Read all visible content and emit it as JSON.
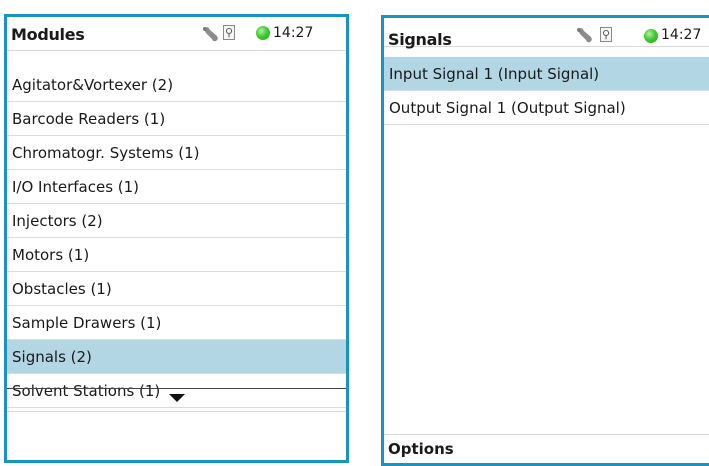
{
  "modules_screen": {
    "title": "Modules",
    "time": "14:27",
    "items": [
      {
        "label": "Agitator&Vortexer (2)"
      },
      {
        "label": "Barcode Readers (1)"
      },
      {
        "label": "Chromatogr. Systems (1)"
      },
      {
        "label": "I/O Interfaces (1)"
      },
      {
        "label": "Injectors (2)"
      },
      {
        "label": "Motors (1)"
      },
      {
        "label": "Obstacles (1)"
      },
      {
        "label": "Sample Drawers (1)"
      },
      {
        "label": "Signals (2)",
        "selected": true
      },
      {
        "label": "Solvent Stations (1)"
      }
    ]
  },
  "signals_screen": {
    "title": "Signals",
    "time": "14:27",
    "items": [
      {
        "label": "Input Signal 1 (Input Signal)",
        "selected": true
      },
      {
        "label": "Output Signal 1 (Output Signal)"
      }
    ],
    "footer_label": "Options"
  },
  "icons": {
    "service": "wrench-icon",
    "usb": "usb-icon",
    "status": "status-indicator",
    "scroll": "arrow-down-icon"
  },
  "colors": {
    "frame": "#1a93c0",
    "selection": "#b3d6e4",
    "status": "#3fcb32"
  }
}
